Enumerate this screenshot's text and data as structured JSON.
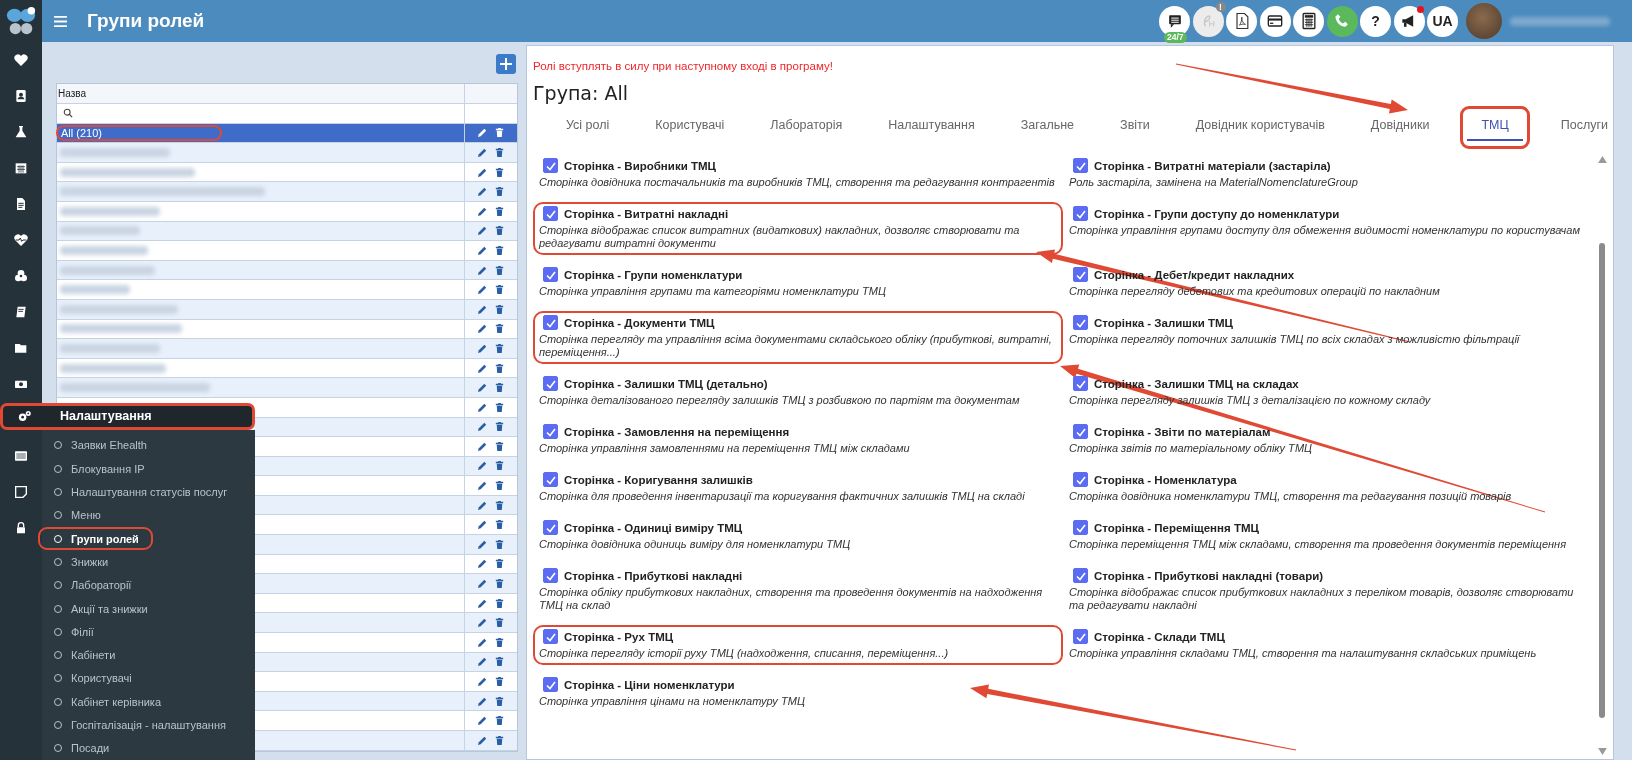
{
  "topbar": {
    "title": "Групи ролей",
    "tools": [
      {
        "kind": "chat",
        "badge": "24/7",
        "disabled": false,
        "dot": false
      },
      {
        "kind": "ehealth",
        "badge": "!",
        "disabled": true,
        "dot": false
      },
      {
        "kind": "pdf",
        "disabled": false,
        "dot": false
      },
      {
        "kind": "card",
        "disabled": false,
        "dot": false
      },
      {
        "kind": "calculator",
        "disabled": false,
        "dot": false
      },
      {
        "kind": "phone",
        "disabled": false,
        "dot": false
      },
      {
        "kind": "help",
        "label": "?",
        "disabled": false,
        "dot": false
      },
      {
        "kind": "announcements",
        "disabled": false,
        "dot": true
      },
      {
        "kind": "language",
        "label": "UA",
        "disabled": false,
        "dot": false
      }
    ]
  },
  "rail_top": [
    {
      "kind": "heart"
    },
    {
      "kind": "contact"
    },
    {
      "kind": "flask"
    },
    {
      "kind": "calendar"
    },
    {
      "kind": "document"
    },
    {
      "kind": "pulse"
    },
    {
      "kind": "gears"
    },
    {
      "kind": "book"
    },
    {
      "kind": "folder"
    },
    {
      "kind": "money"
    }
  ],
  "rail_bottom": [
    {
      "kind": "list"
    },
    {
      "kind": "note"
    },
    {
      "kind": "lock"
    }
  ],
  "settings_menu": {
    "title": "Налаштування",
    "highlighted": true,
    "items": [
      {
        "label": "Заявки Ehealth",
        "selected": false,
        "highlighted": false
      },
      {
        "label": "Блокування IP",
        "selected": false,
        "highlighted": false
      },
      {
        "label": "Налаштування статусів послуг",
        "selected": false,
        "highlighted": false
      },
      {
        "label": "Меню",
        "selected": false,
        "highlighted": false
      },
      {
        "label": "Групи ролей",
        "selected": true,
        "highlighted": true
      },
      {
        "label": "Знижки",
        "selected": false,
        "highlighted": false
      },
      {
        "label": "Лабораторії",
        "selected": false,
        "highlighted": false
      },
      {
        "label": "Акції та знижки",
        "selected": false,
        "highlighted": false
      },
      {
        "label": "Філії",
        "selected": false,
        "highlighted": false
      },
      {
        "label": "Кабінети",
        "selected": false,
        "highlighted": false
      },
      {
        "label": "Користувачі",
        "selected": false,
        "highlighted": false
      },
      {
        "label": "Кабінет керівника",
        "selected": false,
        "highlighted": false
      },
      {
        "label": "Госпіталізація - налаштування",
        "selected": false,
        "highlighted": false
      },
      {
        "label": "Посади",
        "selected": false,
        "highlighted": false
      }
    ]
  },
  "groups_table": {
    "columns": [
      "Назва"
    ],
    "rows": [
      {
        "label": "All (210)",
        "selected": true,
        "highlighted": true,
        "redacted": false
      },
      {
        "selected": false,
        "highlighted": false,
        "redacted": true
      },
      {
        "selected": false,
        "highlighted": false,
        "redacted": true
      },
      {
        "selected": false,
        "highlighted": false,
        "redacted": true
      },
      {
        "selected": false,
        "highlighted": false,
        "redacted": true
      },
      {
        "selected": false,
        "highlighted": false,
        "redacted": true
      },
      {
        "selected": false,
        "highlighted": false,
        "redacted": true
      },
      {
        "selected": false,
        "highlighted": false,
        "redacted": true
      },
      {
        "selected": false,
        "highlighted": false,
        "redacted": true
      },
      {
        "selected": false,
        "highlighted": false,
        "redacted": true
      },
      {
        "selected": false,
        "highlighted": false,
        "redacted": true
      },
      {
        "selected": false,
        "highlighted": false,
        "redacted": true
      },
      {
        "selected": false,
        "highlighted": false,
        "redacted": true
      },
      {
        "selected": false,
        "highlighted": false,
        "redacted": true
      },
      {
        "selected": false
      },
      {
        "selected": false
      },
      {
        "selected": false
      },
      {
        "selected": false
      },
      {
        "selected": false
      },
      {
        "selected": false
      },
      {
        "selected": false
      },
      {
        "selected": false
      },
      {
        "selected": false
      },
      {
        "selected": false
      },
      {
        "selected": false
      },
      {
        "selected": false
      },
      {
        "selected": false
      },
      {
        "selected": false
      },
      {
        "selected": false
      },
      {
        "selected": false
      },
      {
        "selected": false
      },
      {
        "selected": false
      }
    ]
  },
  "group_panel": {
    "notice": "Ролі вступлять в силу при наступному вході в програму!",
    "heading": "Група: All",
    "tabs": [
      {
        "label": "Усі ролі",
        "selected": false,
        "highlighted": false
      },
      {
        "label": "Користувачі",
        "selected": false,
        "highlighted": false
      },
      {
        "label": "Лабораторія",
        "selected": false,
        "highlighted": false
      },
      {
        "label": "Налаштування",
        "selected": false,
        "highlighted": false
      },
      {
        "label": "Загальне",
        "selected": false,
        "highlighted": false
      },
      {
        "label": "Звіти",
        "selected": false,
        "highlighted": false
      },
      {
        "label": "Довідник користувачів",
        "selected": false,
        "highlighted": false
      },
      {
        "label": "Довідники",
        "selected": false,
        "highlighted": false
      },
      {
        "label": "ТМЦ",
        "selected": true,
        "highlighted": true
      },
      {
        "label": "Послуги",
        "selected": false,
        "highlighted": false
      }
    ],
    "roles": [
      {
        "title": "Сторінка - Виробники ТМЦ",
        "description": "Сторінка довідника постачальників та виробників ТМЦ, створення та редагування контрагентів",
        "checked": true,
        "highlighted": false
      },
      {
        "title": "Сторінка - Витратні матеріали (застаріла)",
        "description": "Роль застаріла, замінена на MaterialNomenclatureGroup",
        "checked": true,
        "highlighted": false
      },
      {
        "title": "Сторінка - Витратні накладні",
        "description": "Сторінка відображає список витратних (видаткових) накладних, дозволяє створювати та редагувати витратні документи",
        "checked": true,
        "highlighted": true
      },
      {
        "title": "Сторінка - Групи доступу до номенклатури",
        "description": "Сторінка управління групами доступу для обмеження видимості номенклатури по користувачам",
        "checked": true,
        "highlighted": false
      },
      {
        "title": "Сторінка - Групи номенклатури",
        "description": "Сторінка управління групами та категоріями номенклатури ТМЦ",
        "checked": true,
        "highlighted": false
      },
      {
        "title": "Сторінка - Дебет/кредит накладних",
        "description": "Сторінка перегляду дебетових та кредитових операцій по накладним",
        "checked": true,
        "highlighted": false
      },
      {
        "title": "Сторінка - Документи ТМЦ",
        "description": "Сторінка перегляду та управління всіма документами складського обліку (прибуткові, витратні, переміщення...)",
        "checked": true,
        "highlighted": true
      },
      {
        "title": "Сторінка - Залишки ТМЦ",
        "description": "Сторінка перегляду поточних залишків ТМЦ по всіх складах з можливістю фільтрації",
        "checked": true,
        "highlighted": false
      },
      {
        "title": "Сторінка - Залишки ТМЦ (детально)",
        "description": "Сторінка деталізованого перегляду залишків ТМЦ з розбивкою по партіям та документам",
        "checked": true,
        "highlighted": false
      },
      {
        "title": "Сторінка - Залишки ТМЦ на складах",
        "description": "Сторінка перегляду залишків ТМЦ з деталізацією по кожному складу",
        "checked": true,
        "highlighted": false
      },
      {
        "title": "Сторінка - Замовлення на переміщення",
        "description": "Сторінка управління замовленнями на переміщення ТМЦ між складами",
        "checked": true,
        "highlighted": false
      },
      {
        "title": "Сторінка - Звіти по матеріалам",
        "description": "Сторінка звітів по матеріальному обліку ТМЦ",
        "checked": true,
        "highlighted": false
      },
      {
        "title": "Сторінка - Коригування залишків",
        "description": "Сторінка для проведення інвентаризації та коригування фактичних залишків ТМЦ на складі",
        "checked": true,
        "highlighted": false
      },
      {
        "title": "Сторінка - Номенклатура",
        "description": "Сторінка довідника номенклатури ТМЦ, створення та редагування позицій товарів",
        "checked": true,
        "highlighted": false
      },
      {
        "title": "Сторінка - Одиниці виміру ТМЦ",
        "description": "Сторінка довідника одиниць виміру для номенклатури ТМЦ",
        "checked": true,
        "highlighted": false
      },
      {
        "title": "Сторінка - Переміщення ТМЦ",
        "description": "Сторінка переміщення ТМЦ між складами, створення та проведення документів переміщення",
        "checked": true,
        "highlighted": false
      },
      {
        "title": "Сторінка - Прибуткові накладні",
        "description": "Сторінка обліку прибуткових накладних, створення та проведення документів на надходження ТМЦ на склад",
        "checked": true,
        "highlighted": false
      },
      {
        "title": "Сторінка - Прибуткові накладні (товари)",
        "description": "Сторінка відображає список прибуткових накладних з переліком товарів, дозволяє створювати та редагувати накладні",
        "checked": true,
        "highlighted": false
      },
      {
        "title": "Сторінка - Рух ТМЦ",
        "description": "Сторінка перегляду історії руху ТМЦ (надходження, списання, переміщення...)",
        "checked": true,
        "highlighted": true
      },
      {
        "title": "Сторінка - Склади ТМЦ",
        "description": "Сторінка управління складами ТМЦ, створення та налаштування складських приміщень",
        "checked": true,
        "highlighted": false
      },
      {
        "title": "Сторінка - Ціни номенклатури",
        "description": "Сторінка управління цінами на номенклатуру ТМЦ",
        "checked": true,
        "highlighted": false
      }
    ]
  }
}
